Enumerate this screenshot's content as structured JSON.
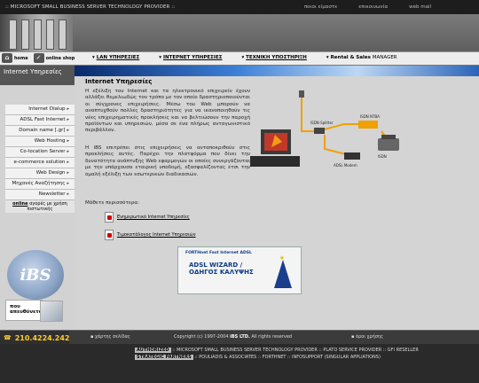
{
  "topbar": {
    "tagline": ":: MICROSOFT SMALL BUSINESS SERVER TECHNOLOGY PROVIDER ::",
    "links": [
      "ποιοι είμαστε",
      "επικοινωνία",
      "web mail"
    ]
  },
  "header_buttons": {
    "home": "home",
    "shop": "online shop"
  },
  "menu": [
    {
      "label": "LAN ΥΠΗΡΕΣΙΕΣ"
    },
    {
      "label": "ΙΝΤΕΡΝΕΤ ΥΠΗΡΕΣΙΕΣ"
    },
    {
      "label": "ΤΕΧΝΙΚΗ ΥΠΟΣΤΗΡΙΞΗ"
    },
    {
      "label": "Rental & Sales",
      "suffix": "MANAGER"
    }
  ],
  "sidebar": {
    "title": "Internet Υπηρεσίες",
    "items": [
      "Internet Dialup",
      "ADSL Fast Internet",
      "Domain name [.gr]",
      "Web Hosting",
      "Co-location Server",
      "e-commerce solution",
      "Web Design",
      "Μηχανές Αναζήτησης",
      "Newsletter"
    ],
    "more_bold": "online",
    "more_rest": "αγορές με χρήση πιστωτικής",
    "logo": "iBS",
    "promo": "που απευθύνεται;"
  },
  "content": {
    "title": "Internet Υπηρεσίες",
    "p1": "Η εξέλιξη του Internet και τα ηλεκτρονικό επιχειρείν έχουν αλλάξει θεμελιωδώς τον τρόπο με τον οποίο δραστηριοποιούνται οι σύγχρονες επιχειρήσεις. Μέσω του Web μπορούν να αναπτυχθούν πολλές δραστηριότητες για να ικανοποιηθούν τις νέες επιχειρηματικές προκλήσεις και να βελτιώσουν την παροχή προϊόντων και υπηρεσιών, μέσα σε ένα πλήρως ανταγωνιστικό περιβάλλον.",
    "p2": "Η iBS επιτρέπει στις επιχειρήσεις να ανταποκριθούν στις προκλήσεις αυτές. Παρέχει την πλατφόρμα που δίνει την δυνατότητα ανάπτυξης Web εφαρμογών οι οποίες συνεργάζονται με την υπάρχουσα εταιρική υποδομή, εξασφαλίζοντας έτσι την ομαλή εξέλιξη των εσωτερικών διαδικασιών.",
    "p3": "Μάθετε περισσότερα:",
    "downloads": [
      "Ενημερωτικό Internet Υπηρεσίες",
      "Τιμοκατάλογος Internet Υπηρεσιών"
    ],
    "diagram_labels": [
      "ISDN Splitter",
      "ISDN NTBA",
      "ADSL Modem",
      "ISDN"
    ],
    "wizard": {
      "small": "FORTHnet Fast Internet ADSL",
      "line1": "ADSL WIZARD /",
      "line2": "ΟΔΗΓΟΣ ΚΑΛΥΨΗΣ"
    }
  },
  "footer": {
    "phone": "210.4224.242",
    "sitemap": "χάρτης σελίδας",
    "copyright_pre": "Copyright (c) 1997-2004",
    "copyright_co": "iBS LTD.",
    "copyright_post": "All rights reserved",
    "terms": "όροι χρήσης"
  },
  "bottom": {
    "line1_tag": "AUTHORIZED",
    "line1": ":: MICROSOFT SMALL BUSINESS SERVER TECHNOLOGY PROVIDER :: PLATO SERVICE PROVIDER :: GFI RESELLER",
    "line2_tag": "STRATEGIC PARTNERS",
    "line2": ":: POULIADIS & ASSOCIATES :: FORTHNET :: INFOSUPPORT (SINGULAR APPLIATIONS)"
  }
}
